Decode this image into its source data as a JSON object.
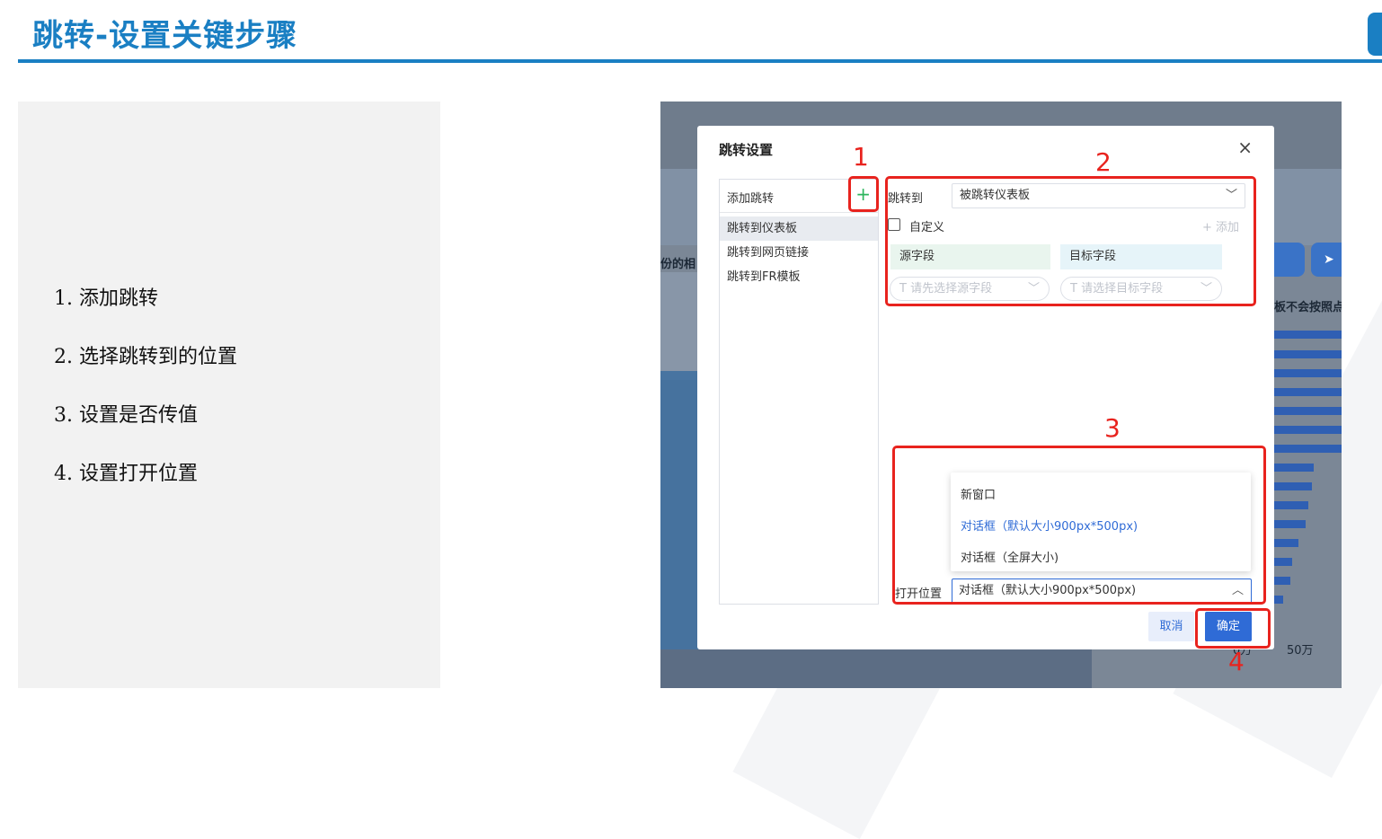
{
  "slide": {
    "title": "跳转-设置关键步骤",
    "steps": [
      "1. 添加跳转",
      "2. 选择跳转到的位置",
      "3. 设置是否传值",
      "4. 设置打开位置"
    ]
  },
  "background": {
    "left_label": "份的相",
    "right_label": "板不会按照点",
    "axis_label": "50万",
    "bottom_label": "0万",
    "arrow": "➤"
  },
  "dialog": {
    "title": "跳转设置",
    "close": "×",
    "left_panel": {
      "header": "添加跳转",
      "add_icon": "+",
      "items": [
        "跳转到仪表板",
        "跳转到网页链接",
        "跳转到FR模板"
      ]
    },
    "jump_to": {
      "label": "跳转到",
      "value": "被跳转仪表板"
    },
    "custom": {
      "label": "自定义",
      "add": "+ 添加"
    },
    "fields": {
      "source_header": "源字段",
      "target_header": "目标字段",
      "source_placeholder": "T 请先选择源字段",
      "target_placeholder": "T 请选择目标字段"
    },
    "open_position": {
      "label": "打开位置",
      "value": "对话框（默认大小900px*500px)",
      "options": [
        "新窗口",
        "对话框（默认大小900px*500px)",
        "对话框（全屏大小)"
      ],
      "selected_index": 1
    },
    "buttons": {
      "cancel": "取消",
      "ok": "确定"
    }
  },
  "annotations": [
    "1",
    "2",
    "3",
    "4"
  ],
  "colors": {
    "accent": "#1a7fc3",
    "annotation": "#e8231e",
    "primary_button": "#2f6bd6"
  }
}
